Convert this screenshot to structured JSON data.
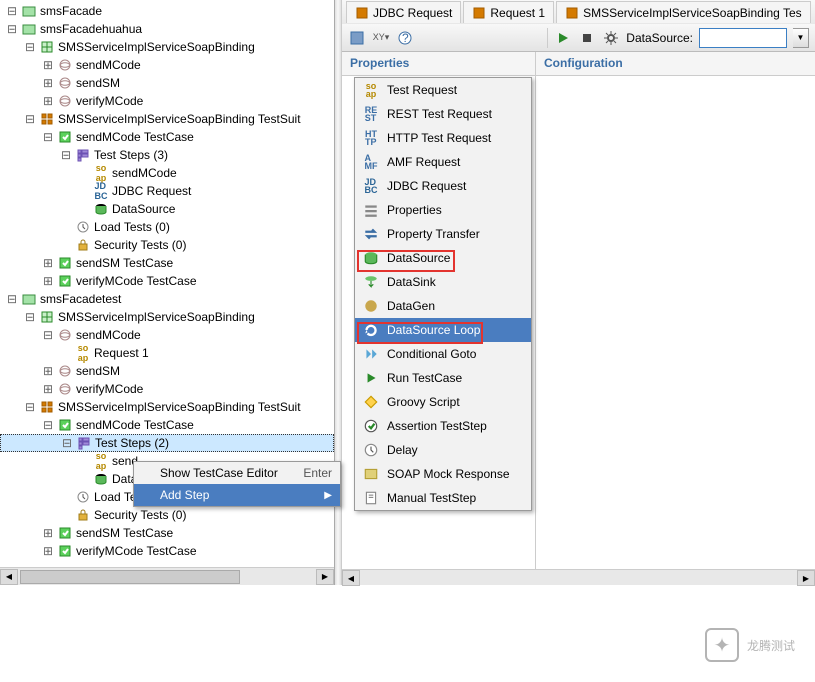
{
  "tabs": [
    {
      "label": "JDBC Request",
      "icon": "jdbc-icon"
    },
    {
      "label": "Request 1",
      "icon": "soap-icon"
    },
    {
      "label": "SMSServiceImplServiceSoapBinding Tes",
      "icon": "suite-icon"
    }
  ],
  "toolbar": {
    "ds_label": "DataSource:",
    "right": {
      "properties": "Properties",
      "configuration": "Configuration"
    }
  },
  "tree": [
    {
      "pad": 0,
      "exp": "−",
      "icon": "proj",
      "label": "smsFacade"
    },
    {
      "pad": 0,
      "exp": "−",
      "icon": "proj",
      "label": "smsFacadehuahua"
    },
    {
      "pad": 1,
      "exp": "−",
      "icon": "int",
      "label": "SMSServiceImplServiceSoapBinding"
    },
    {
      "pad": 2,
      "exp": "+",
      "icon": "op",
      "label": "sendMCode"
    },
    {
      "pad": 2,
      "exp": "+",
      "icon": "op",
      "label": "sendSM"
    },
    {
      "pad": 2,
      "exp": "+",
      "icon": "op",
      "label": "verifyMCode"
    },
    {
      "pad": 1,
      "exp": "−",
      "icon": "suite",
      "label": "SMSServiceImplServiceSoapBinding TestSuit"
    },
    {
      "pad": 2,
      "exp": "−",
      "icon": "case",
      "label": "sendMCode TestCase"
    },
    {
      "pad": 3,
      "exp": "−",
      "icon": "steps",
      "label": "Test Steps (3)"
    },
    {
      "pad": 4,
      "exp": "",
      "icon": "soap",
      "label": "sendMCode"
    },
    {
      "pad": 4,
      "exp": "",
      "icon": "jdbc",
      "label": "JDBC Request"
    },
    {
      "pad": 4,
      "exp": "",
      "icon": "dsrc",
      "label": "DataSource"
    },
    {
      "pad": 3,
      "exp": "",
      "icon": "clock",
      "label": "Load Tests (0)"
    },
    {
      "pad": 3,
      "exp": "",
      "icon": "lock",
      "label": "Security Tests (0)"
    },
    {
      "pad": 2,
      "exp": "+",
      "icon": "case",
      "label": "sendSM TestCase"
    },
    {
      "pad": 2,
      "exp": "+",
      "icon": "case",
      "label": "verifyMCode TestCase"
    },
    {
      "pad": 0,
      "exp": "−",
      "icon": "proj",
      "label": "smsFacadetest"
    },
    {
      "pad": 1,
      "exp": "−",
      "icon": "int",
      "label": "SMSServiceImplServiceSoapBinding"
    },
    {
      "pad": 2,
      "exp": "−",
      "icon": "op",
      "label": "sendMCode"
    },
    {
      "pad": 3,
      "exp": "",
      "icon": "soap",
      "label": "Request 1"
    },
    {
      "pad": 2,
      "exp": "+",
      "icon": "op",
      "label": "sendSM"
    },
    {
      "pad": 2,
      "exp": "+",
      "icon": "op",
      "label": "verifyMCode"
    },
    {
      "pad": 1,
      "exp": "−",
      "icon": "suite",
      "label": "SMSServiceImplServiceSoapBinding TestSuit"
    },
    {
      "pad": 2,
      "exp": "−",
      "icon": "case",
      "label": "sendMCode TestCase"
    },
    {
      "pad": 3,
      "exp": "−",
      "icon": "steps",
      "label": "Test Steps (2)",
      "selected": true
    },
    {
      "pad": 4,
      "exp": "",
      "icon": "soap",
      "label": "send"
    },
    {
      "pad": 4,
      "exp": "",
      "icon": "dsrc",
      "label": "Data"
    },
    {
      "pad": 3,
      "exp": "",
      "icon": "clock",
      "label": "Load Te"
    },
    {
      "pad": 3,
      "exp": "",
      "icon": "lock",
      "label": "Security Tests (0)"
    },
    {
      "pad": 2,
      "exp": "+",
      "icon": "case",
      "label": "sendSM TestCase"
    },
    {
      "pad": 2,
      "exp": "+",
      "icon": "case",
      "label": "verifyMCode TestCase"
    }
  ],
  "context_menu": [
    {
      "label": "Show TestCase Editor",
      "shortcut": "Enter"
    },
    {
      "label": "Add Step",
      "highlighted": true,
      "has_submenu": true
    }
  ],
  "step_menu": [
    {
      "label": "Test Request",
      "icon": "soap"
    },
    {
      "label": "REST Test Request",
      "icon": "rest"
    },
    {
      "label": "HTTP Test Request",
      "icon": "http"
    },
    {
      "label": "AMF Request",
      "icon": "amf"
    },
    {
      "label": "JDBC Request",
      "icon": "jdbc"
    },
    {
      "label": "Properties",
      "icon": "props"
    },
    {
      "label": "Property Transfer",
      "icon": "transfer"
    },
    {
      "label": "DataSource",
      "icon": "dsrc"
    },
    {
      "label": "DataSink",
      "icon": "dsink"
    },
    {
      "label": "DataGen",
      "icon": "dgen"
    },
    {
      "label": "DataSource Loop",
      "icon": "dloop",
      "highlighted": true
    },
    {
      "label": "Conditional Goto",
      "icon": "goto"
    },
    {
      "label": "Run TestCase",
      "icon": "run"
    },
    {
      "label": "Groovy Script",
      "icon": "groovy"
    },
    {
      "label": "Assertion TestStep",
      "icon": "assert"
    },
    {
      "label": "Delay",
      "icon": "delay"
    },
    {
      "label": "SOAP Mock Response",
      "icon": "mock"
    },
    {
      "label": "Manual TestStep",
      "icon": "manual"
    }
  ],
  "watermark": "龙腾测试"
}
